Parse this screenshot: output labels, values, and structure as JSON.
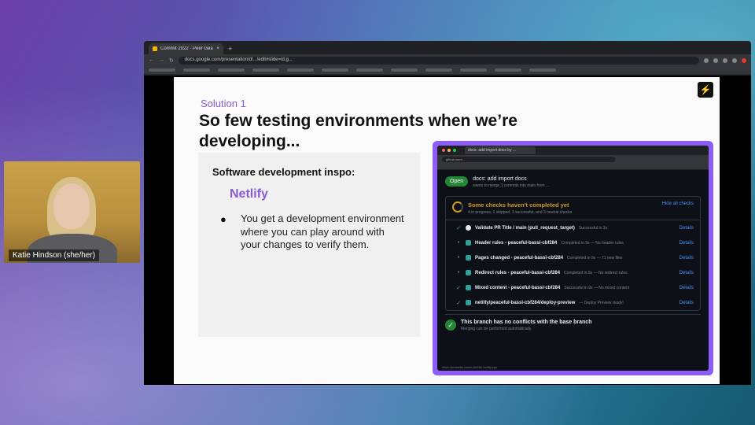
{
  "webcam": {
    "name": "Katie Hindson (she/her)"
  },
  "browser": {
    "tab_title": "Commit 2022 · Peer Gear",
    "new_tab": "+",
    "address": "docs.google.com/presentation/d/.../edit#slide=id.g..."
  },
  "slide": {
    "solution_label": "Solution 1",
    "title": "So few testing environments when we’re developing...",
    "bolt_icon": "⚡",
    "inspo_heading": "Software development inspo:",
    "inspo_sub": "Netlify",
    "bullet": "●",
    "bullet_text": "You get a development environment where you can play around with your changes to verify them."
  },
  "github": {
    "mini_tab": "docs: add import docs by ...",
    "mini_address": "github.com/...",
    "open_badge": "Open",
    "pr_title": "docs: add import docs",
    "pr_meta": "wants to merge 1 commits into main from ...",
    "checks_title": "Some checks haven't completed yet",
    "checks_sub": "4 in progress, 1 skipped, 3 successful, and 3 neutral checks",
    "hide_checks": "Hide all checks",
    "details": "Details",
    "rows": [
      {
        "status": "✓",
        "name": "Validate PR Title / main (pull_request_target)",
        "desc": "Successful in 3s"
      },
      {
        "status": "•",
        "name": "Header rules - peaceful-bassi-cbf284",
        "desc": "Completed in 9s — No header rules"
      },
      {
        "status": "•",
        "name": "Pages changed - peaceful-bassi-cbf284",
        "desc": "Completed in 9s — 71 new files"
      },
      {
        "status": "•",
        "name": "Redirect rules - peaceful-bassi-cbf284",
        "desc": "Completed in 9s — No redirect rules"
      },
      {
        "status": "✓",
        "name": "Mixed content - peaceful-bassi-cbf284",
        "desc": "Successful in 9s — No mixed content"
      },
      {
        "status": "✓",
        "name": "netlify/peaceful-bassi-cbf284/deploy-preview",
        "desc": "— Deploy Preview ready!"
      }
    ],
    "merge_title": "This branch has no conflicts with the base branch",
    "merge_sub": "Merging can be performed automatically.",
    "status_bar": "https://peaceful-bassi-cbf284.netlify.app"
  },
  "colors": {
    "accent": "#8a5bd6",
    "frame": "#8b5cf6",
    "success": "#238636",
    "pending": "#d29922"
  }
}
